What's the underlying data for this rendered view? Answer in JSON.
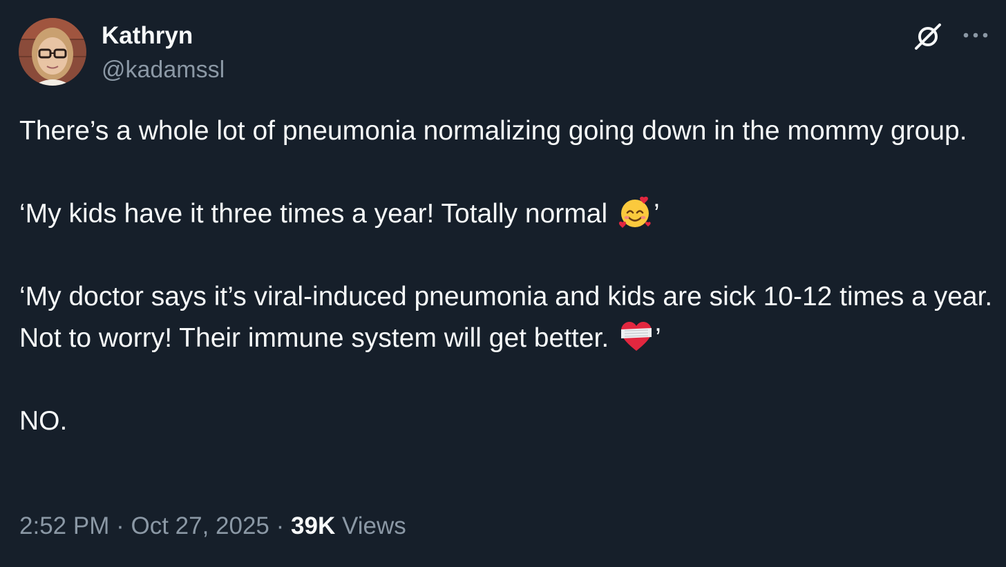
{
  "author": {
    "display_name": "Kathryn",
    "handle": "@kadamssl"
  },
  "header_actions": {
    "grok_icon": "grok-slash-circle-icon",
    "more_icon": "more-dots-icon"
  },
  "tweet": {
    "line1": "There’s a whole lot of pneumonia normalizing going down in the mommy group.",
    "quote1_text": "‘My kids have it three times a year! Totally normal ",
    "quote1_emoji": "smiling-face-with-hearts-emoji",
    "quote1_end": "’",
    "quote2_text": "‘My doctor says it’s viral-induced pneumonia and kids are sick 10-12 times a year. Not to worry! Their immune system will get better. ",
    "quote2_emoji": "mending-heart-emoji",
    "quote2_end": "’",
    "closing": "NO."
  },
  "meta": {
    "time": "2:52 PM",
    "separator": "·",
    "date": "Oct 27, 2025",
    "views_count": "39K",
    "views_label": "Views"
  },
  "colors": {
    "background": "#161f2a",
    "primary_text": "#f7f9f9",
    "secondary_text": "#8b98a5"
  }
}
